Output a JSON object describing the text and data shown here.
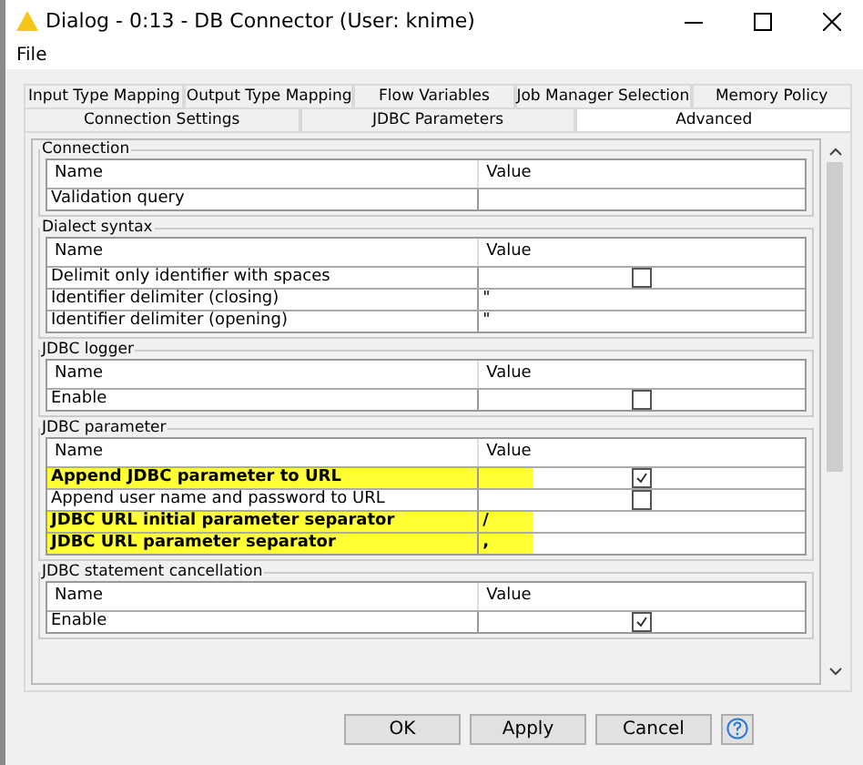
{
  "window": {
    "title": "Dialog - 0:13 - DB Connector (User: knime)"
  },
  "menu": [
    "File"
  ],
  "tab_rows": [
    [
      {
        "label": "Input Type Mapping",
        "selected": false
      },
      {
        "label": "Output Type Mapping",
        "selected": false
      },
      {
        "label": "Flow Variables",
        "selected": false
      },
      {
        "label": "Job Manager Selection",
        "selected": false
      },
      {
        "label": "Memory Policy",
        "selected": false
      }
    ],
    [
      {
        "label": "Connection Settings",
        "selected": false
      },
      {
        "label": "JDBC Parameters",
        "selected": false
      },
      {
        "label": "Advanced",
        "selected": true
      }
    ]
  ],
  "groups": [
    {
      "title": "Connection",
      "columns": [
        "Name",
        "Value"
      ],
      "rows": [
        {
          "kind": "text",
          "name": "Validation query",
          "highlighted": false
        }
      ]
    },
    {
      "title": "Dialect syntax",
      "columns": [
        "Name",
        "Value"
      ],
      "rows": [
        {
          "kind": "checkbox",
          "name": "Delimit only identifier with spaces",
          "checked": false,
          "highlighted": false
        },
        {
          "kind": "text",
          "name": "Identifier delimiter (closing)",
          "value": "\"",
          "highlighted": false
        },
        {
          "kind": "text",
          "name": "Identifier delimiter (opening)",
          "value": "\"",
          "highlighted": false
        }
      ]
    },
    {
      "title": "JDBC logger",
      "columns": [
        "Name",
        "Value"
      ],
      "rows": [
        {
          "kind": "checkbox",
          "name": "Enable",
          "checked": false,
          "highlighted": false
        }
      ]
    },
    {
      "title": "JDBC parameter",
      "columns": [
        "Name",
        "Value"
      ],
      "rows": [
        {
          "kind": "checkbox",
          "name": "Append JDBC parameter to URL",
          "checked": true,
          "highlighted": true
        },
        {
          "kind": "checkbox",
          "name": "Append user name and password to URL",
          "checked": false,
          "highlighted": false
        },
        {
          "kind": "text",
          "name": "JDBC URL initial parameter separator",
          "value": "/",
          "highlighted": true
        },
        {
          "kind": "text",
          "name": "JDBC URL parameter separator",
          "value": ",",
          "highlighted": true
        }
      ]
    },
    {
      "title": "JDBC statement cancellation",
      "columns": [
        "Name",
        "Value"
      ],
      "rows": [
        {
          "kind": "checkbox",
          "name": "Enable",
          "checked": true,
          "highlighted": false
        }
      ]
    }
  ],
  "buttons": [
    {
      "kind": "text",
      "label": "OK"
    },
    {
      "kind": "text",
      "label": "Apply"
    },
    {
      "kind": "text",
      "label": "Cancel"
    },
    {
      "kind": "help"
    }
  ]
}
